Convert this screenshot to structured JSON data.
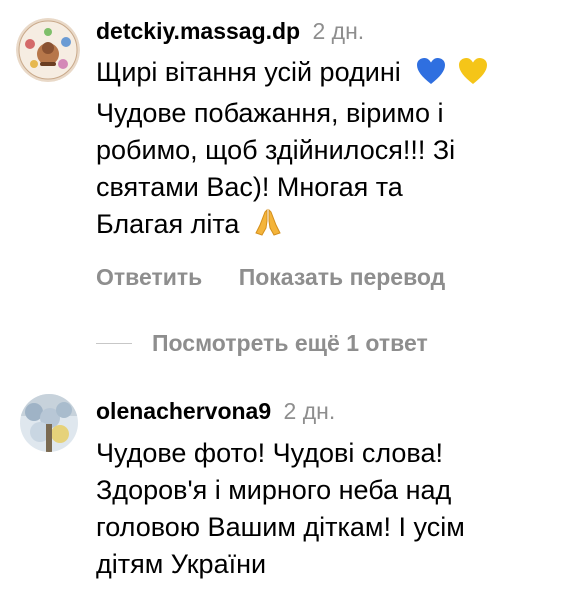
{
  "comments": [
    {
      "username": "detckiy.massag.dp",
      "time": "2 дн.",
      "line1": "Щирі вітання усій родині",
      "line2": "Чудове побажання, віримо і",
      "line3": "робимо, щоб здійнилося!!! Зі",
      "line4": "святами Вас)! Многая та",
      "line5": "Благая літа",
      "emojis": [
        "blue-heart-icon",
        "yellow-heart-icon",
        "folded-hands-icon"
      ],
      "reply_label": "Ответить",
      "translate_label": "Показать перевод"
    },
    {
      "username": "olenachervona9",
      "time": "2 дн.",
      "line1": "Чудове фото! Чудові слова!",
      "line2": "Здоров'я і мирного неба над",
      "line3": "головою Вашим діткам! І усім",
      "line4": "дітям України"
    }
  ],
  "view_more": {
    "label": "Посмотреть ещё 1 ответ"
  },
  "colors": {
    "secondary_text": "#8e8e8e",
    "blue_heart": "#2f6fe0",
    "yellow_heart": "#f5c518"
  }
}
